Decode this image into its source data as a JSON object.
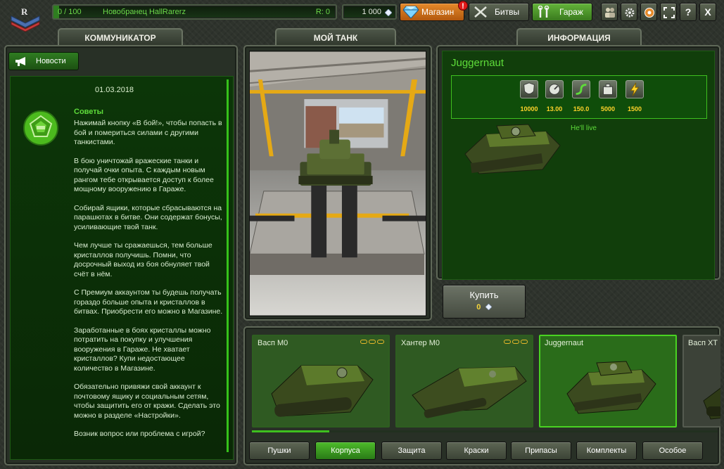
{
  "top_bar": {
    "progress": "0 / 100",
    "player_name": "Новобранец HallRarerz",
    "rating": "R: 0",
    "crystals": "1 000",
    "shop_label": "Магазин",
    "shop_alert": "!",
    "battles_label": "Битвы",
    "garage_label": "Гараж",
    "help_label": "?",
    "close_label": "X"
  },
  "tabs": {
    "communicator": "Коммуникатор",
    "my_tank": "Мой танк",
    "information": "Информация"
  },
  "news": {
    "button_label": "Новости",
    "date": "01.03.2018",
    "title": "Советы",
    "paragraphs": [
      "Нажимай кнопку «В бой!», чтобы попасть в бой и помериться силами с другими танкистами.",
      "В бою уничтожай вражеские танки и получай очки опыта. С каждым новым рангом тебе открывается доступ к более мощному вооружению в Гараже.",
      "Собирай ящики, которые сбрасываются на парашютах в битве. Они содержат бонусы, усиливающие твой танк.",
      "Чем лучше ты сражаешься, тем больше кристаллов получишь. Помни, что досрочный выход из боя обнуляет твой счёт в нём.",
      "С Премиум аккаунтом ты будешь получать гораздо больше опыта и кристаллов в битвах. Приобрести его можно в Магазине.",
      "Заработанные в боях кристаллы можно потратить на покупку и улучшения вооружения в Гараже. Не хватает кристаллов? Купи недостающее количество в Магазине.",
      "Обязательно привяжи свой аккаунт к почтовому ящику и социальным сетям, чтобы защитить его от кражи. Сделать это можно в разделе «Настройки».",
      "Возник вопрос или проблема с игрой?"
    ]
  },
  "item_info": {
    "title": "Juggernaut",
    "description": "He'll live",
    "stats": [
      {
        "icon": "armor-icon",
        "value": "10000"
      },
      {
        "icon": "speed-icon",
        "value": "13.00"
      },
      {
        "icon": "turn-speed-icon",
        "value": "150.0"
      },
      {
        "icon": "weight-icon",
        "value": "5000"
      },
      {
        "icon": "power-icon",
        "value": "1500"
      }
    ],
    "buy_label": "Купить",
    "buy_price": "0"
  },
  "garage_items": [
    {
      "name": "Васп M0",
      "state": "owned"
    },
    {
      "name": "Хантер M0",
      "state": "owned"
    },
    {
      "name": "Juggernaut",
      "state": "selected"
    },
    {
      "name": "Васп XT",
      "state": "locked"
    }
  ],
  "categories": [
    {
      "label": "Пушки",
      "active": false
    },
    {
      "label": "Корпуса",
      "active": true
    },
    {
      "label": "Защита",
      "active": false
    },
    {
      "label": "Краски",
      "active": false
    },
    {
      "label": "Припасы",
      "active": false
    },
    {
      "label": "Комплекты",
      "active": false
    },
    {
      "label": "Особое",
      "active": false
    }
  ],
  "colors": {
    "accent_green": "#5edc3a",
    "shop_orange": "#e58a2a",
    "stat_yellow": "#ffd32a"
  }
}
